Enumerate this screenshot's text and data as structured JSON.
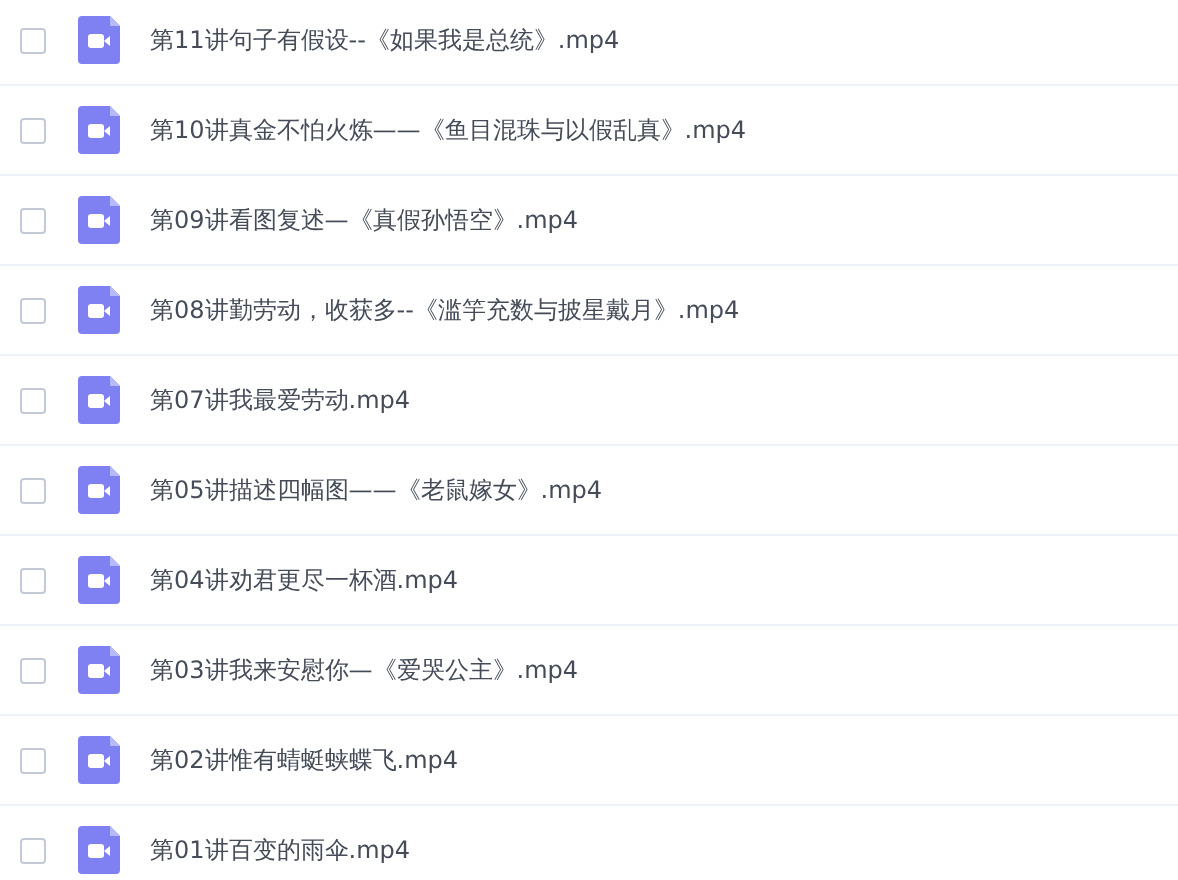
{
  "files": [
    {
      "name": "第11讲句子有假设--《如果我是总统》.mp4",
      "checked": false
    },
    {
      "name": "第10讲真金不怕火炼——《鱼目混珠与以假乱真》.mp4",
      "checked": false
    },
    {
      "name": "第09讲看图复述—《真假孙悟空》.mp4",
      "checked": false
    },
    {
      "name": "第08讲勤劳动，收获多--《滥竽充数与披星戴月》.mp4",
      "checked": false
    },
    {
      "name": "第07讲我最爱劳动.mp4",
      "checked": false
    },
    {
      "name": "第05讲描述四幅图——《老鼠嫁女》.mp4",
      "checked": false
    },
    {
      "name": "第04讲劝君更尽一杯酒.mp4",
      "checked": false
    },
    {
      "name": "第03讲我来安慰你—《爱哭公主》.mp4",
      "checked": false
    },
    {
      "name": "第02讲惟有蜻蜓蛱蝶飞.mp4",
      "checked": false
    },
    {
      "name": "第01讲百变的雨伞.mp4",
      "checked": false
    }
  ]
}
